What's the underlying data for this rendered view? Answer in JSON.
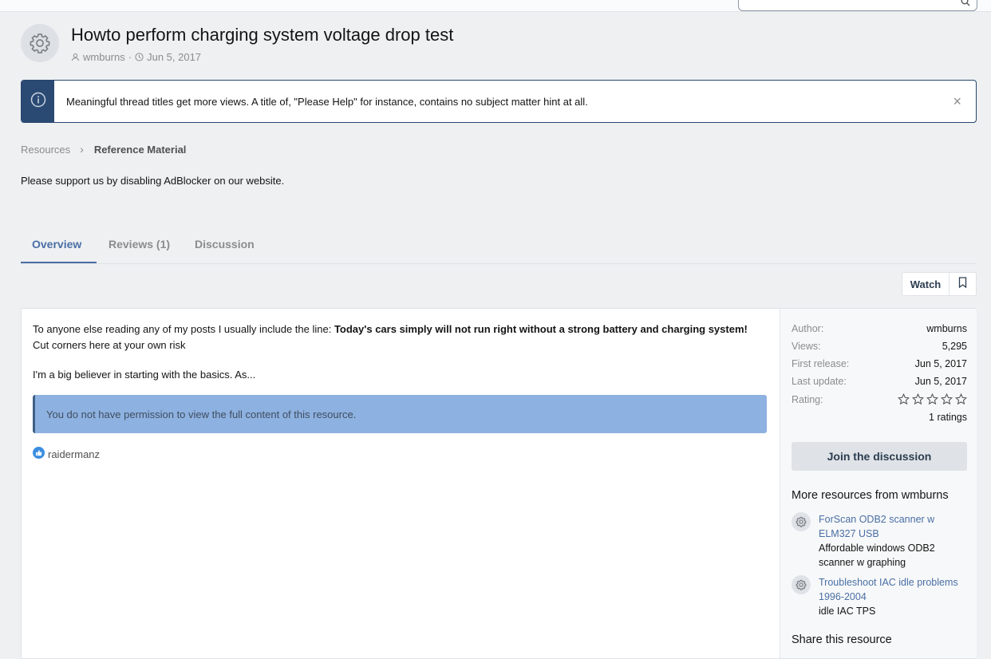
{
  "resource": {
    "title": "Howto perform charging system voltage drop test",
    "author": "wmburns",
    "date": "Jun 5, 2017"
  },
  "notice": {
    "text": "Meaningful thread titles get more views. A title of, \"Please Help\" for instance, contains no subject matter hint at all.",
    "close_label": "×"
  },
  "breadcrumb": {
    "items": [
      "Resources",
      "Reference Material"
    ]
  },
  "ad_note": "Please support us by disabling AdBlocker on our website.",
  "tabs": [
    "Overview",
    "Reviews (1)",
    "Discussion"
  ],
  "actions": {
    "watch_label": "Watch"
  },
  "post": {
    "intro": "To anyone else reading any of my posts I usually include the line: ",
    "bold": "Today's cars simply will not run right without a strong battery and charging system!",
    "tail": " Cut corners here at your own risk",
    "second": "I'm a big believer in starting with the basics. As...",
    "permission": "You do not have permission to view the full content of this resource.",
    "liker": "raidermanz"
  },
  "info": {
    "author_label": "Author:",
    "author_value": "wmburns",
    "views_label": "Views:",
    "views_value": "5,295",
    "first_label": "First release:",
    "first_value": "Jun 5, 2017",
    "last_label": "Last update:",
    "last_value": "Jun 5, 2017",
    "rating_label": "Rating:",
    "rating_stars": 0,
    "ratings_count": "1 ratings"
  },
  "join_label": "Join the discussion",
  "more": {
    "title": "More resources from wmburns",
    "items": [
      {
        "title": "ForScan ODB2 scanner w ELM327 USB",
        "desc": "Affordable windows ODB2 scanner w graphing"
      },
      {
        "title": "Troubleshoot IAC idle problems 1996-2004",
        "desc": "idle IAC TPS"
      }
    ]
  },
  "share_title": "Share this resource",
  "colors": {
    "accent": "#4a6fa5",
    "notice_side": "#2b4a73",
    "permission_bg": "#8db1e0"
  }
}
